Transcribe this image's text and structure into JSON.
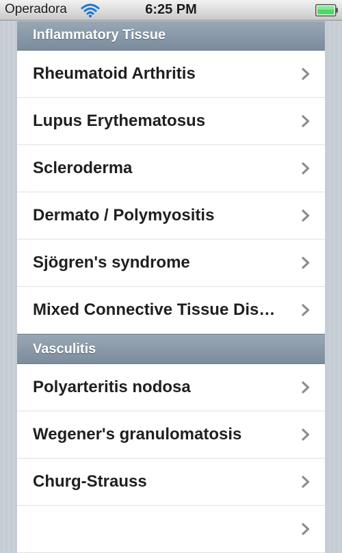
{
  "status_bar": {
    "carrier": "Operadora",
    "time": "6:25 PM",
    "wifi_icon": "wifi-icon",
    "battery_icon": "battery-full-icon",
    "battery_color": "#4cd964"
  },
  "colors": {
    "section_header": "#8a9aab",
    "row_text": "#1f1f1f",
    "chevron": "#8c8c8c"
  },
  "sections": [
    {
      "title": "Inflammatory Tissue",
      "items": [
        {
          "label": "Rheumatoid Arthritis"
        },
        {
          "label": "Lupus Erythematosus"
        },
        {
          "label": "Scleroderma"
        },
        {
          "label": "Dermato / Polymyositis"
        },
        {
          "label": "Sjögren's syndrome"
        },
        {
          "label": "Mixed Connective Tissue Dis…"
        }
      ]
    },
    {
      "title": "Vasculitis",
      "items": [
        {
          "label": "Polyarteritis nodosa"
        },
        {
          "label": "Wegener's granulomatosis"
        },
        {
          "label": "Churg-Strauss"
        },
        {
          "label": ""
        }
      ]
    }
  ]
}
